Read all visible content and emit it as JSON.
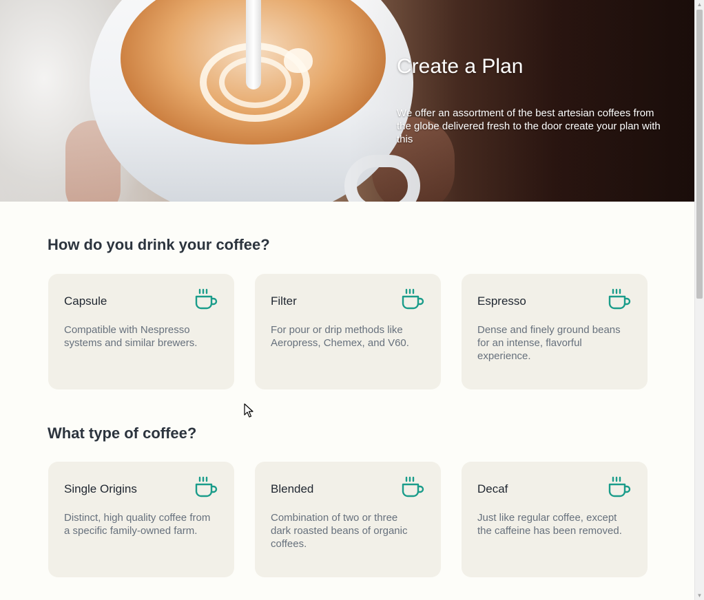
{
  "hero": {
    "title": "Create a Plan",
    "text": "We offer an assortment of the best artesian coffees from the globe delivered fresh to the door create your plan with this"
  },
  "sections": [
    {
      "title": "How do you drink your coffee?",
      "cards": [
        {
          "title": "Capsule",
          "desc": "Compatible with Nespresso systems and similar brewers.",
          "icon": "coffee-cup-icon"
        },
        {
          "title": "Filter",
          "desc": "For pour or drip methods like Aeropress, Chemex, and V60.",
          "icon": "coffee-cup-icon"
        },
        {
          "title": "Espresso",
          "desc": "Dense and finely ground beans for an intense, flavorful experience.",
          "icon": "coffee-cup-icon"
        }
      ]
    },
    {
      "title": "What type of coffee?",
      "cards": [
        {
          "title": "Single Origins",
          "desc": "Distinct, high quality coffee from a specific family-owned farm.",
          "icon": "coffee-cup-icon"
        },
        {
          "title": "Blended",
          "desc": "Combination of two or three dark roasted beans of organic coffees.",
          "icon": "coffee-cup-icon"
        },
        {
          "title": "Decaf",
          "desc": "Just like regular coffee, except the caffeine has been removed.",
          "icon": "coffee-cup-icon"
        }
      ]
    }
  ],
  "colors": {
    "accent": "#1a9c8a",
    "card_bg": "#f2f0e8",
    "page_bg": "#fdfdf9",
    "heading": "#2c343e",
    "body_text": "#66707c"
  }
}
